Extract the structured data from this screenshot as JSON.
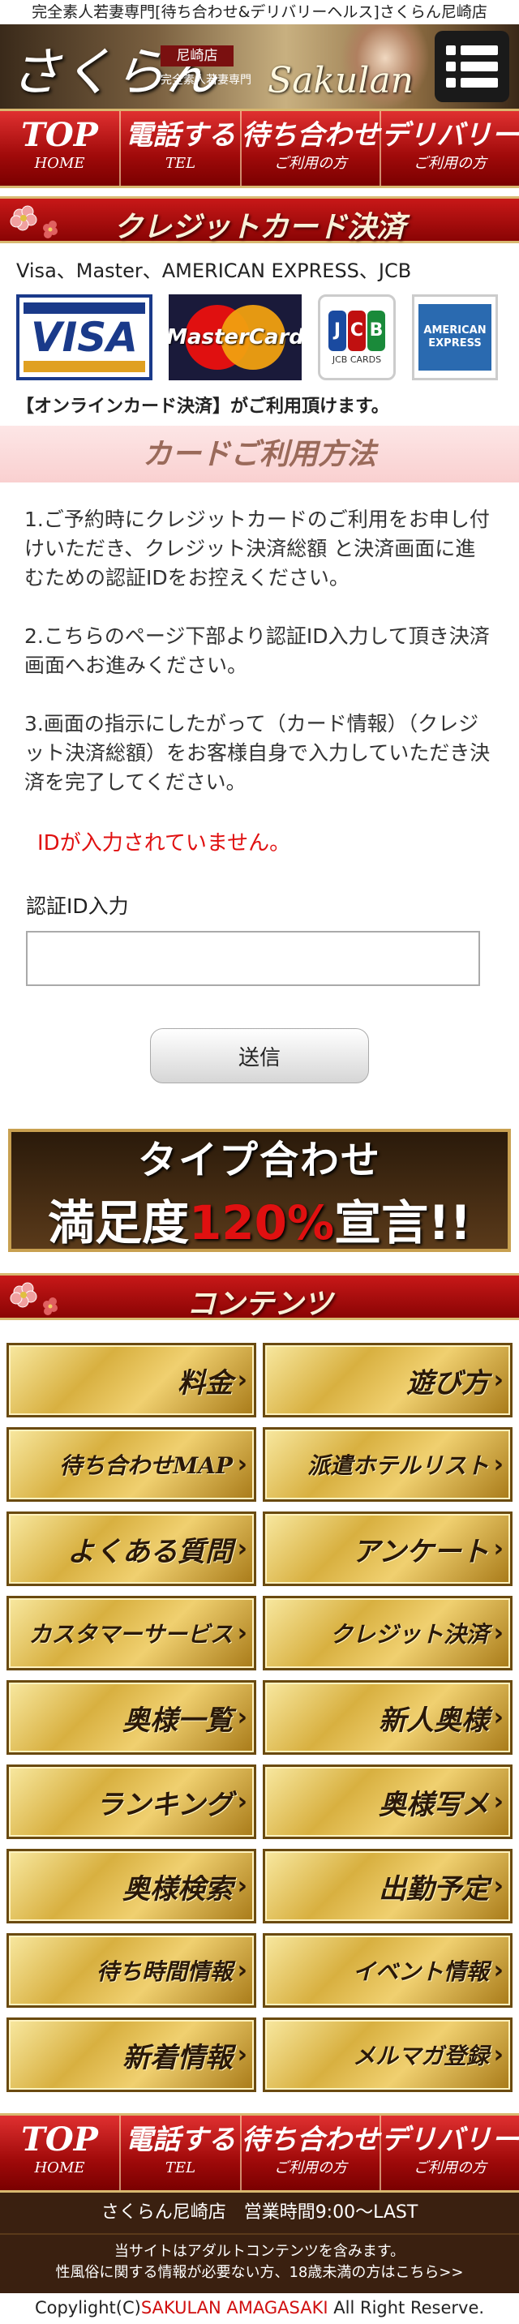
{
  "header": {
    "top_line": "完全素人若妻専門[待ち合わせ&デリバリーヘルス]さくらん尼崎店",
    "logo_text": "さくらん",
    "badge": "尼崎店",
    "sub": "完全素人若妻専門",
    "script": "Sakulan",
    "menu_icon": "menu-icon"
  },
  "nav": [
    {
      "main": "TOP",
      "sub": "HOME"
    },
    {
      "main": "電話する",
      "sub": "TEL"
    },
    {
      "main": "待ち合わせ",
      "sub": "ご利用の方"
    },
    {
      "main": "デリバリー",
      "sub": "ご利用の方"
    }
  ],
  "credit": {
    "title": "クレジットカード決済",
    "brands_line": "Visa、Master、AMERICAN EXPRESS、JCB",
    "cards": {
      "visa": "VISA",
      "mastercard": "MasterCard",
      "jcb_letters": [
        "J",
        "C",
        "B"
      ],
      "jcb_small": "JCB CARDS",
      "amex": "AMERICAN EXPRESS"
    },
    "online_note": "【オンラインカード決済】がご利用頂けます。"
  },
  "usage": {
    "title": "カードご利用方法",
    "steps": [
      "1.ご予約時にクレジットカードのご利用をお申し付けいただき、クレジット決済総額 と決済画面に進むための認証IDをお控えください。",
      "2.こちらのページ下部より認証ID入力して頂き決済画面へお進みください。",
      "3.画面の指示にしたがって（カード情報）（クレジット決済総額）をお客様自身で入力していただき決済を完了してください。"
    ],
    "error": "IDが入力されていません。",
    "id_label": "認証ID入力",
    "id_value": "",
    "send_label": "送信"
  },
  "promo": {
    "line1": "タイプ合わせ",
    "line2_pre": "満足度",
    "line2_hot": "120%",
    "line2_post": "宣言!!"
  },
  "contents": {
    "title": "コンテンツ",
    "items": [
      "料金",
      "遊び方",
      "待ち合わせMAP",
      "派遣ホテルリスト",
      "よくある質問",
      "アンケート",
      "カスタマーサービス",
      "クレジット決済",
      "奥様一覧",
      "新人奥様",
      "ランキング",
      "奥様写メ",
      "奥様検索",
      "出勤予定",
      "待ち時間情報",
      "イベント情報",
      "新着情報",
      "メルマガ登録"
    ]
  },
  "footer": {
    "info": "さくらん尼崎店　営業時間9:00～LAST",
    "warn1": "当サイトはアダルトコンテンツを含みます。",
    "warn2": "性風俗に関する情報が必要ない方、18歳未満の方はこちら>>",
    "copyright_pre": "Copylight(C)",
    "copyright_brand": "SAKULAN AMAGASAKI",
    "copyright_post": " All Right Reserve."
  },
  "colors": {
    "nav_red": "#b01010",
    "gold": "#d8b040",
    "error_red": "#e01010",
    "footer_brown": "#3a2010"
  }
}
